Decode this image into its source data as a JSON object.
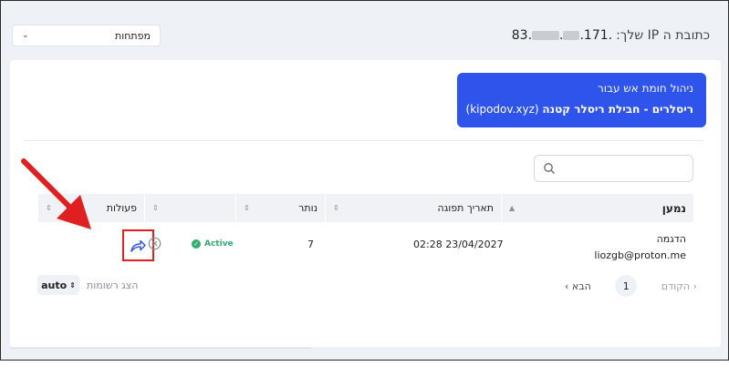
{
  "header": {
    "ip_label": "כתובת ה IP שלך:",
    "ip_first": "83.",
    "ip_last": "171.",
    "keys_select": "מפתחות"
  },
  "banner": {
    "line1": "ניהול חומת אש עבור",
    "line2_bold": "ריסלרים - חבילת ריסלר קטנה",
    "line2_domain": "(kipodov.xyz)"
  },
  "search": {
    "placeholder": ""
  },
  "table": {
    "headers": {
      "name": "נמען",
      "expiry": "תאריך תפוגה",
      "remaining": "נותר",
      "blank": "",
      "actions": "פעולות"
    },
    "rows": [
      {
        "name": "הדגמה",
        "email": "liozgb@proton.me",
        "expiry": "02:28 23/04/2027",
        "remaining": "7",
        "status": "Active"
      }
    ]
  },
  "pager": {
    "prev": "הקודם",
    "page": "1",
    "next": "הבא"
  },
  "records": {
    "label": "הצג רשומות",
    "value": "auto"
  },
  "colors": {
    "accent_blue": "#2f54ec",
    "active_green": "#2fae6e",
    "highlight_red": "#e02020"
  }
}
